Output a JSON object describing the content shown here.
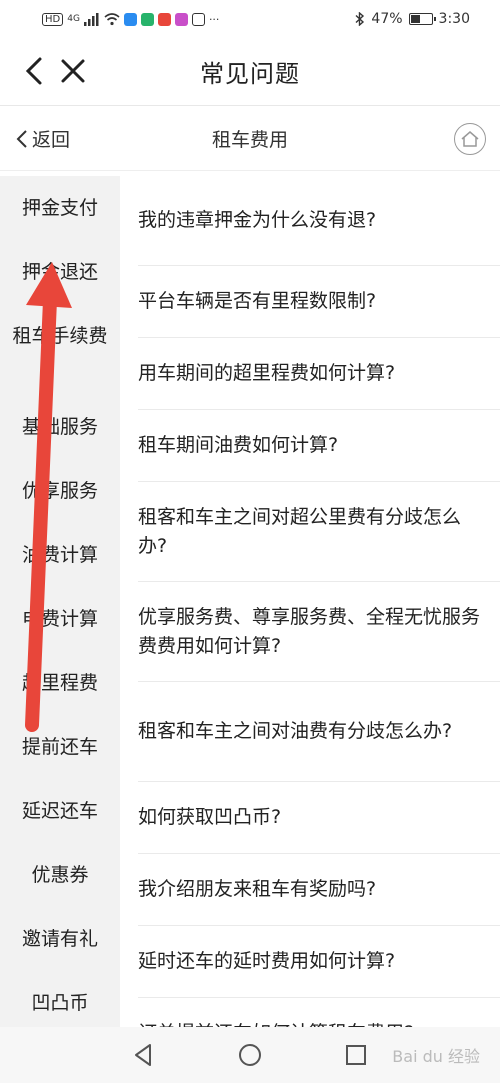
{
  "status": {
    "network": "4G",
    "battery_pct": "47%",
    "battery_level": 0.47,
    "time": "3:30",
    "more": "···"
  },
  "titlebar": {
    "title": "常见问题"
  },
  "subbar": {
    "back_label": "返回",
    "title": "租车费用"
  },
  "sidebar": {
    "items": [
      {
        "label": "押金支付"
      },
      {
        "label": "押金退还"
      },
      {
        "label": "租车手续费"
      },
      {
        "label": "基础服务"
      },
      {
        "label": "优享服务"
      },
      {
        "label": "油费计算"
      },
      {
        "label": "电费计算"
      },
      {
        "label": "超里程费"
      },
      {
        "label": "提前还车"
      },
      {
        "label": "延迟还车"
      },
      {
        "label": "优惠券"
      },
      {
        "label": "邀请有礼"
      },
      {
        "label": "凹凸币"
      }
    ]
  },
  "questions": [
    {
      "text": "我的违章押金为什么没有退?"
    },
    {
      "text": "平台车辆是否有里程数限制?"
    },
    {
      "text": "用车期间的超里程费如何计算?"
    },
    {
      "text": "租车期间油费如何计算?"
    },
    {
      "text": "租客和车主之间对超公里费有分歧怎么办?"
    },
    {
      "text": "优享服务费、尊享服务费、全程无忧服务费费用如何计算?"
    },
    {
      "text": "租客和车主之间对油费有分歧怎么办?"
    },
    {
      "text": "如何获取凹凸币?"
    },
    {
      "text": "我介绍朋友来租车有奖励吗?"
    },
    {
      "text": "延时还车的延时费用如何计算?"
    },
    {
      "text": "订单提前还车如何计算租车费用?"
    }
  ],
  "watermark": "Bai du 经验",
  "colors": {
    "sidebar_bg": "#f2f2f2",
    "arrow": "#e8463a",
    "text": "#222222"
  }
}
